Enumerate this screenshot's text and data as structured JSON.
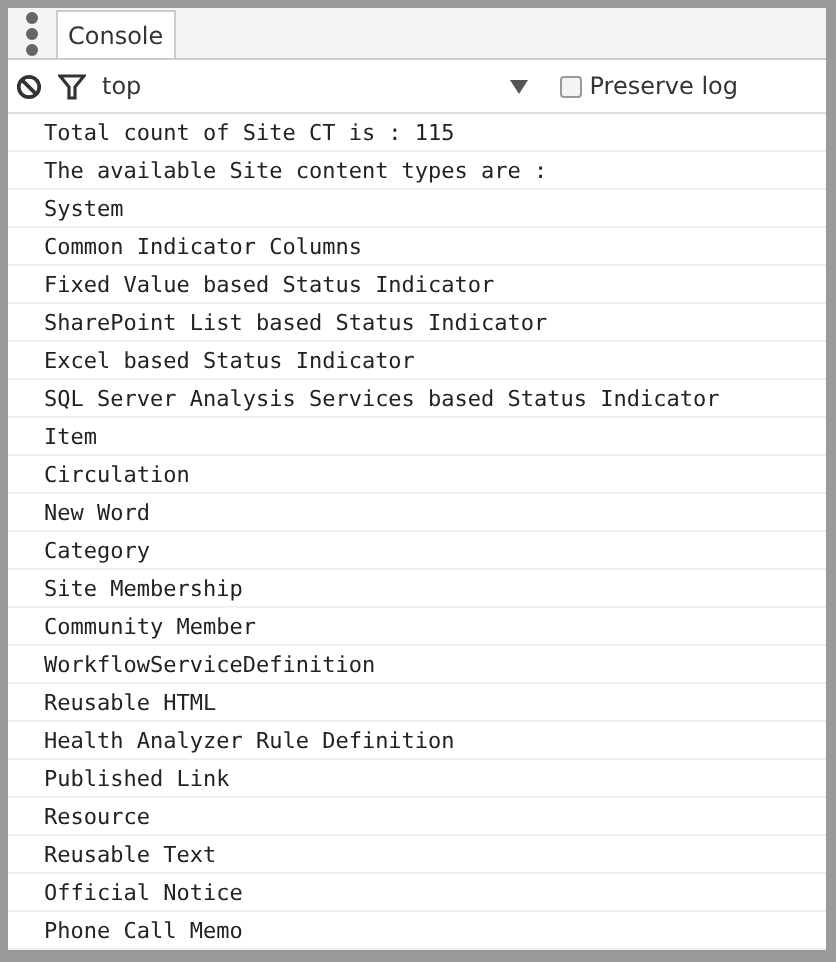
{
  "tabs": [
    {
      "label": "Console",
      "selected": true
    }
  ],
  "toolbar": {
    "context": "top",
    "preserve_log": {
      "label": "Preserve log",
      "checked": false
    }
  },
  "messages": [
    "Total count of Site CT is : 115",
    "The available Site content types are :",
    "System",
    "Common Indicator Columns",
    "Fixed Value based Status Indicator",
    "SharePoint List based Status Indicator",
    "Excel based Status Indicator",
    "SQL Server Analysis Services based Status Indicator",
    "Item",
    "Circulation",
    "New Word",
    "Category",
    "Site Membership",
    "Community Member",
    "WorkflowServiceDefinition",
    "Reusable HTML",
    "Health Analyzer Rule Definition",
    "Published Link",
    "Resource",
    "Reusable Text",
    "Official Notice",
    "Phone Call Memo"
  ]
}
